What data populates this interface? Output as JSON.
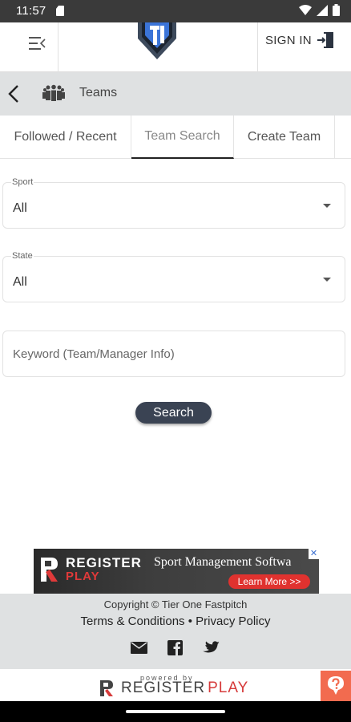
{
  "status": {
    "time": "11:57"
  },
  "header": {
    "signin_label": "SIGN IN"
  },
  "subbar": {
    "title": "Teams"
  },
  "tabs": [
    {
      "label": "Followed / Recent"
    },
    {
      "label": "Team Search"
    },
    {
      "label": "Create Team"
    }
  ],
  "form": {
    "sport": {
      "label": "Sport",
      "value": "All"
    },
    "state": {
      "label": "State",
      "value": "All"
    },
    "keyword": {
      "placeholder": "Keyword (Team/Manager Info)"
    },
    "search_label": "Search"
  },
  "ad": {
    "brand_top": "REGISTER",
    "brand_bottom": "PLAY",
    "headline": "Sport Management Softwa",
    "cta": "Learn More >>",
    "close": "✕"
  },
  "footer": {
    "copyright": "Copyright © Tier One Fastpitch",
    "terms": "Terms & Conditions",
    "separator": "•",
    "privacy": "Privacy Policy"
  },
  "powered": {
    "label": "powered by",
    "brand_a": "REGISTER",
    "brand_b": "PLAY"
  },
  "colors": {
    "accent": "#3a4353",
    "help": "#f26b4f",
    "brand_red": "#d63a3a"
  },
  "icons": [
    "sd-card-icon",
    "wifi-icon",
    "signal-icon",
    "battery-icon",
    "menu-collapse-icon",
    "tier-one-logo",
    "signin-door-icon",
    "back-arrow-icon",
    "teams-icon",
    "dropdown-caret-icon",
    "email-icon",
    "facebook-icon",
    "twitter-icon",
    "help-icon"
  ]
}
